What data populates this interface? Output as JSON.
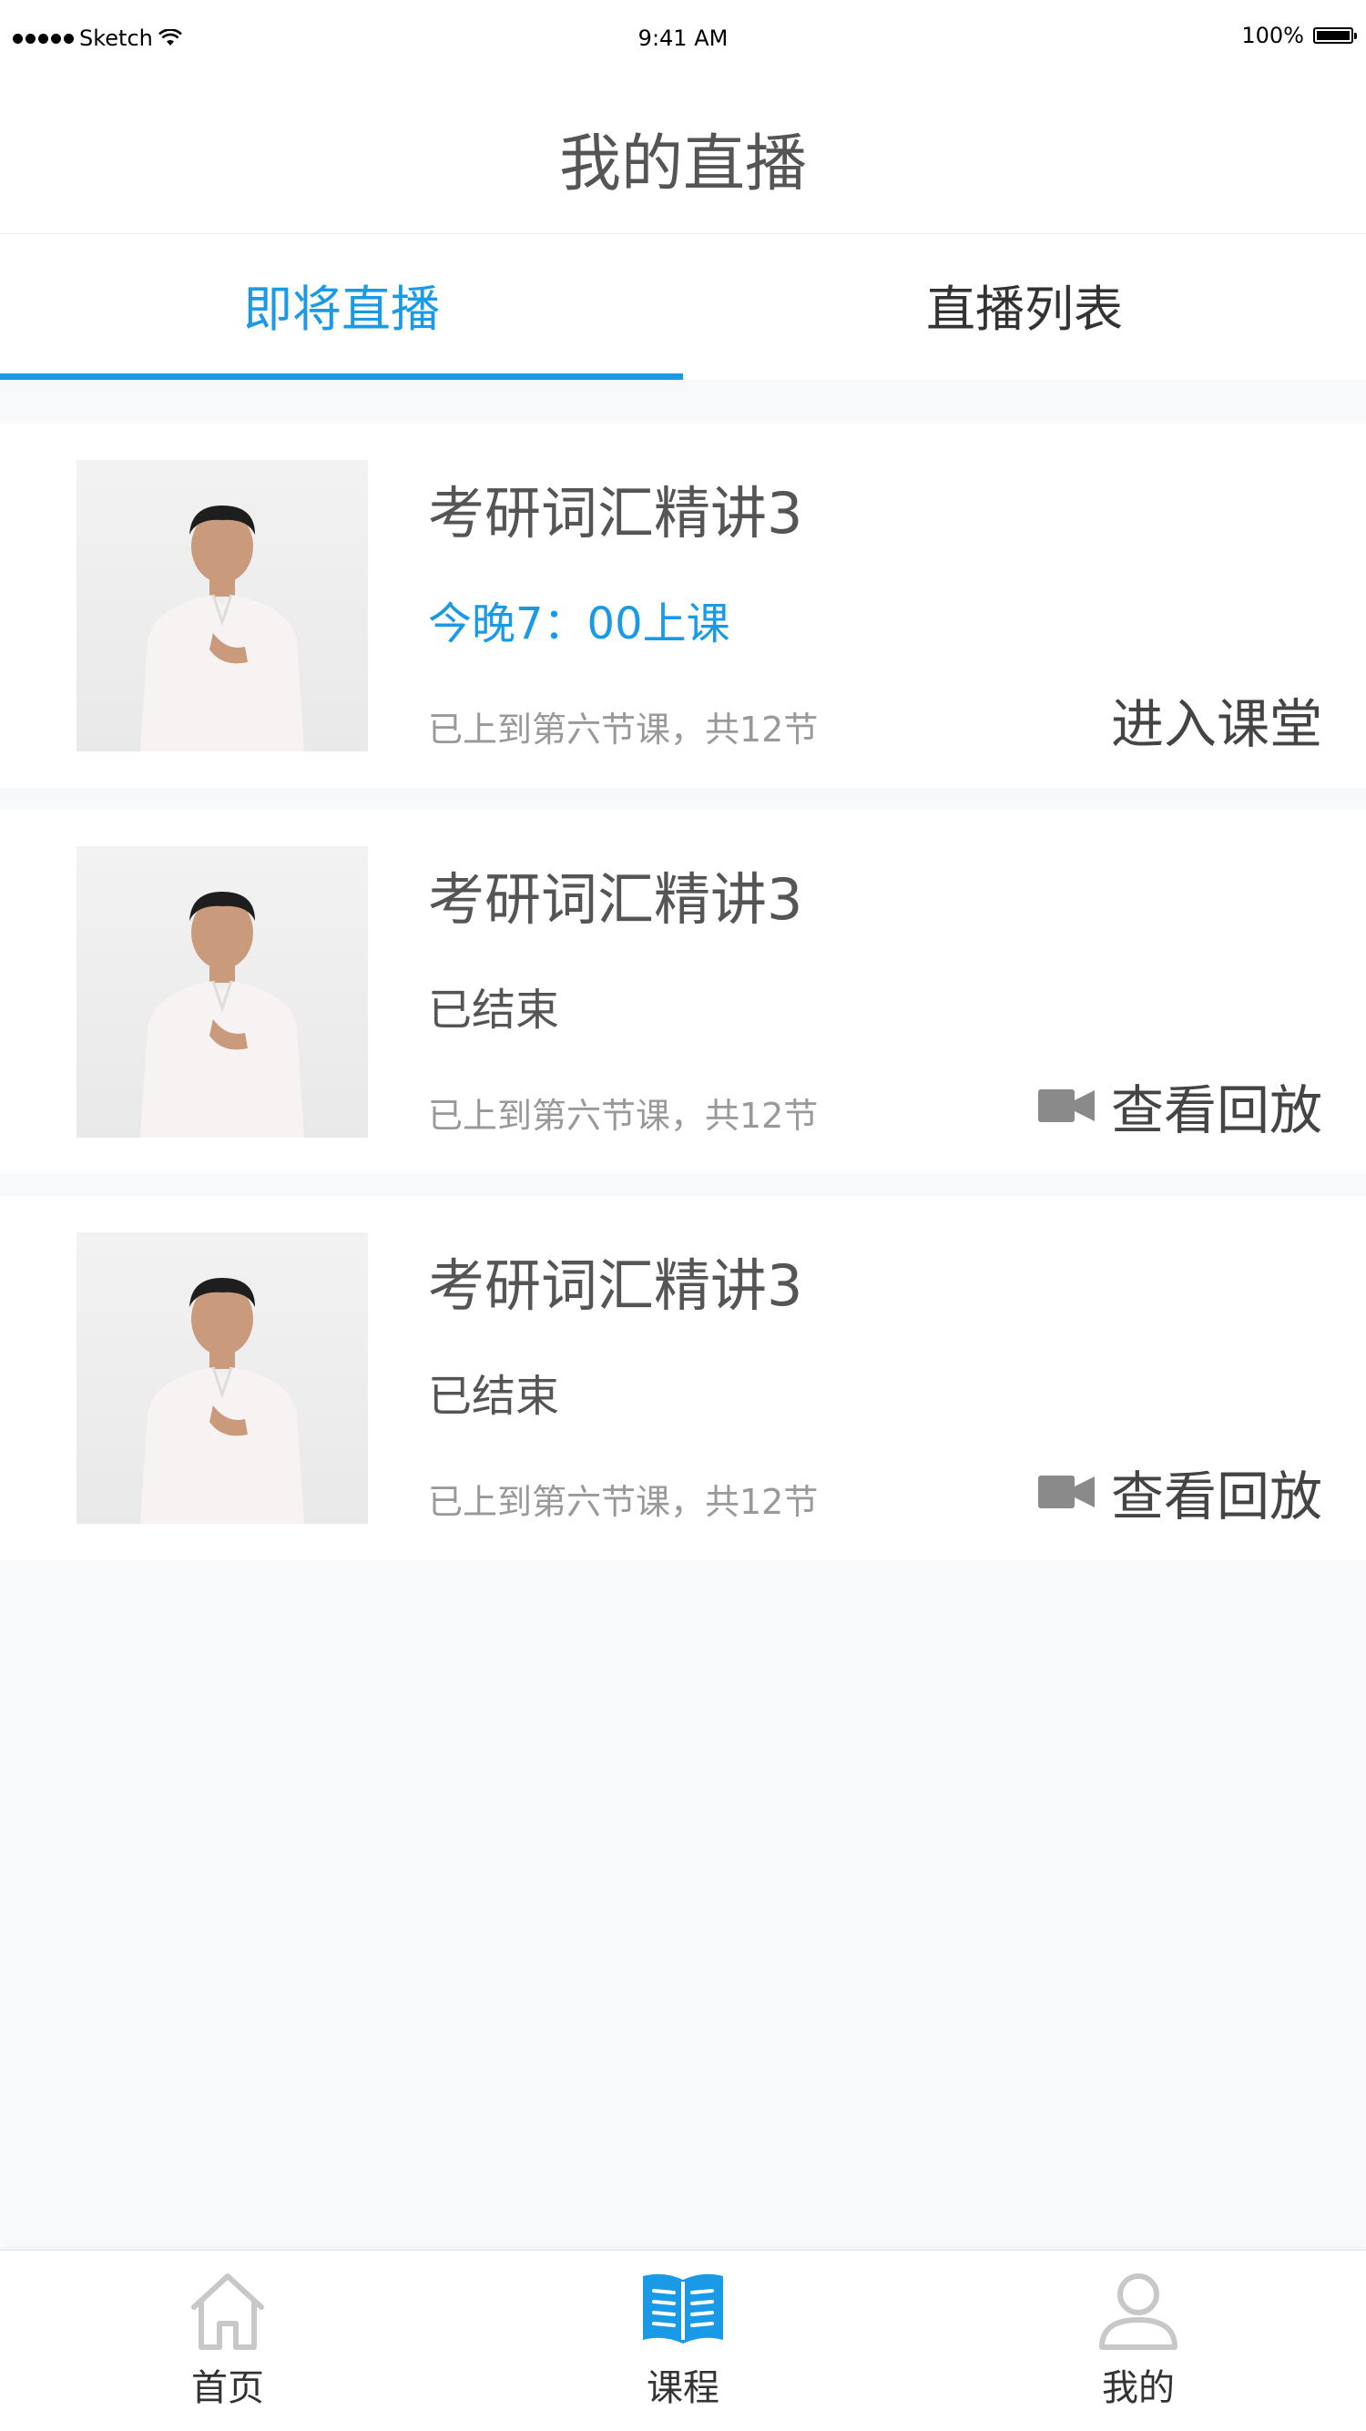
{
  "status_bar": {
    "carrier": "Sketch",
    "time": "9:41 AM",
    "battery": "100%"
  },
  "header": {
    "title": "我的直播"
  },
  "tabs": [
    {
      "label": "即将直播",
      "active": true
    },
    {
      "label": "直播列表",
      "active": false
    }
  ],
  "courses": [
    {
      "title": "考研词汇精讲3",
      "status": "今晚7：00上课",
      "status_kind": "live",
      "progress": "已上到第六节课，共12节",
      "action": "进入课堂",
      "action_icon": ""
    },
    {
      "title": "考研词汇精讲3",
      "status": "已结束",
      "status_kind": "ended",
      "progress": "已上到第六节课，共12节",
      "action": "查看回放",
      "action_icon": "video-camera-icon"
    },
    {
      "title": "考研词汇精讲3",
      "status": "已结束",
      "status_kind": "ended",
      "progress": "已上到第六节课，共12节",
      "action": "查看回放",
      "action_icon": "video-camera-icon"
    }
  ],
  "bottom_nav": [
    {
      "label": "首页",
      "icon": "home-icon"
    },
    {
      "label": "课程",
      "icon": "book-icon",
      "active": true
    },
    {
      "label": "我的",
      "icon": "user-icon"
    }
  ],
  "colors": {
    "accent": "#1a9ae6",
    "inactive_icon": "#c8c8c8",
    "video_icon": "#8a8a8a"
  }
}
